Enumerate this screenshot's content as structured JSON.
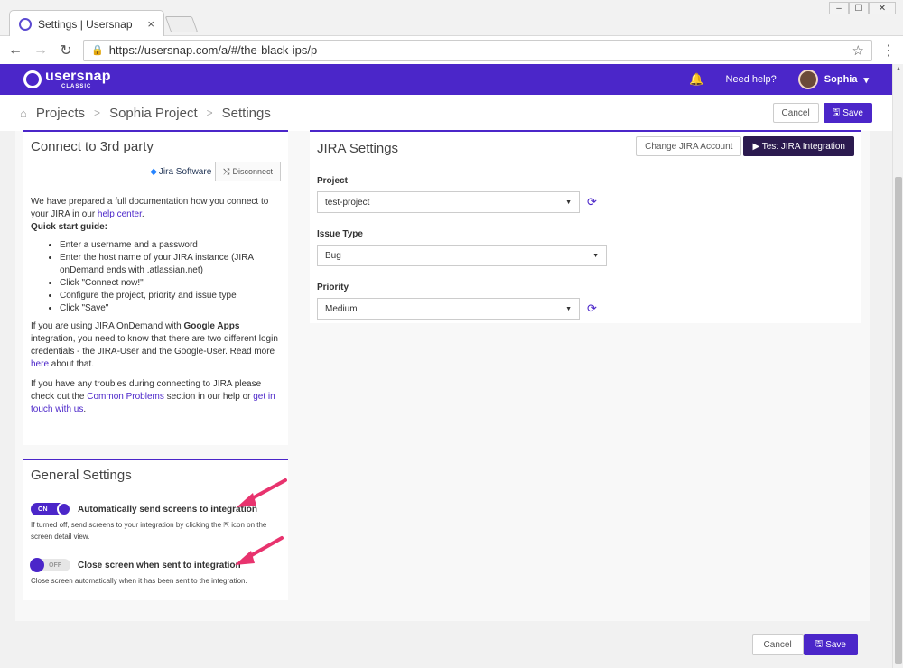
{
  "browser": {
    "tab_title": "Settings | Usersnap",
    "tab_close": "×",
    "url": "https://usersnap.com/a/#/the-black-ips/p",
    "back": "←",
    "forward": "→",
    "reload": "↻",
    "lock": "🔒",
    "star": "☆",
    "menu": "⋮",
    "win_min": "–",
    "win_max": "☐",
    "win_close": "✕"
  },
  "header": {
    "logo_main": "usersnap",
    "logo_sub": "CLASSIC",
    "bell": "🔔",
    "help": "Need help?",
    "user": "Sophia",
    "user_caret": "▾"
  },
  "breadcrumb": {
    "home": "⌂",
    "items": [
      "Projects",
      "Sophia Project",
      "Settings"
    ],
    "sep": ">"
  },
  "actions": {
    "cancel": "Cancel",
    "save": "Save",
    "save_icon": "🖫"
  },
  "connect": {
    "title": "Connect to 3rd party",
    "jira_logo": "Jira Software",
    "jira_mark": "◆",
    "disconnect": "Disconnect",
    "disconnect_icon": "⤭",
    "doc_intro_1": "We have prepared a full documentation how you connect to your JIRA in our ",
    "doc_help_link": "help center",
    "doc_intro_2": ".",
    "quick_title": "Quick start guide:",
    "steps": [
      "Enter a username and a password",
      "Enter the host name of your JIRA instance (JIRA onDemand ends with .atlassian.net)",
      "Click \"Connect now!\"",
      "Configure the project, priority and issue type",
      "Click \"Save\""
    ],
    "p2_a": "If you are using JIRA OnDemand with ",
    "p2_b": "Google Apps",
    "p2_c": " integration, you need to know that there are two different login credentials - the JIRA-User and the Google-User. Read more ",
    "p2_link": "here",
    "p2_d": " about that.",
    "p3_a": "If you have any troubles during connecting to JIRA please check out the ",
    "p3_link1": "Common Problems",
    "p3_b": " section in our help or ",
    "p3_link2": "get in touch with us",
    "p3_c": "."
  },
  "general": {
    "title": "General Settings",
    "t1_state": "ON",
    "t1_label": "Automatically send screens to integration",
    "t1_help_a": "If turned off, send screens to your integration by clicking the ",
    "t1_help_icon": "⇱",
    "t1_help_b": " icon on the screen detail view.",
    "t2_state": "OFF",
    "t2_label": "Close screen when sent to integration",
    "t2_help": "Close screen automatically when it has been sent to the integration."
  },
  "jira": {
    "title": "JIRA Settings",
    "change_account": "Change JIRA Account",
    "test": "▶ Test JIRA Integration",
    "project_label": "Project",
    "project_value": "test-project",
    "issue_label": "Issue Type",
    "issue_value": "Bug",
    "priority_label": "Priority",
    "priority_value": "Medium",
    "caret": "▼",
    "refresh": "⟳"
  },
  "colors": {
    "brand": "#4b26c9",
    "dark_button": "#2b1a4f",
    "arrow": "#e8336e"
  }
}
